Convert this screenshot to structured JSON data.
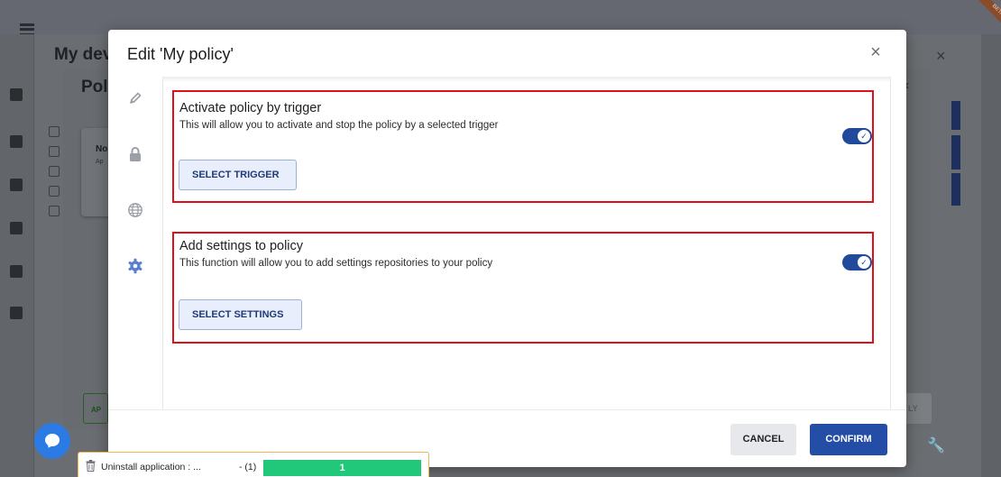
{
  "background": {
    "page_title_partial": "My dev",
    "inner_title_partial": "Pol",
    "card_title_partial": "No",
    "card_sub_partial": "Ap",
    "left_button_partial": "AP",
    "right_button_partial": "LY",
    "beta_label": "BETA"
  },
  "modal": {
    "title": "Edit 'My policy'",
    "close_icon": "close-icon",
    "rail_icons": [
      "pencil-icon",
      "lock-icon",
      "globe-icon",
      "gear-icon"
    ],
    "sections": [
      {
        "title": "Activate policy by trigger",
        "description": "This will allow you to activate and stop the policy by a selected trigger",
        "toggle_on": true,
        "button_label": "SELECT TRIGGER"
      },
      {
        "title": "Add settings to policy",
        "description": "This function will allow you to add settings repositories to your policy",
        "toggle_on": true,
        "button_label": "SELECT SETTINGS"
      }
    ],
    "cancel_label": "CANCEL",
    "confirm_label": "CONFIRM"
  },
  "task": {
    "label": "Uninstall application : ...",
    "count": "- (1)",
    "progress_value": "1",
    "progress_fraction": 1.0
  },
  "colors": {
    "accent": "#244ea5",
    "highlight_border": "#e0101a",
    "progress": "#22c879",
    "chat": "#2c7be5"
  }
}
